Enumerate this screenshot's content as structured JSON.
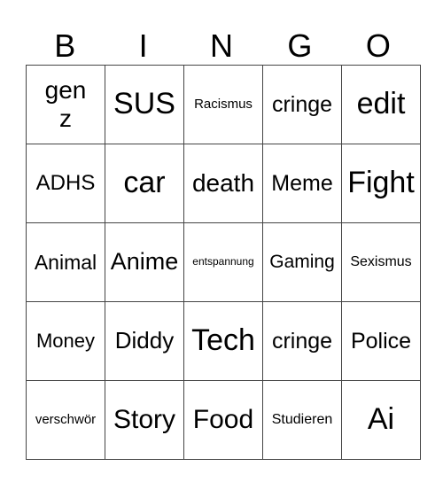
{
  "header": [
    "B",
    "I",
    "N",
    "G",
    "O"
  ],
  "cells": [
    [
      {
        "t": "gen z",
        "s": 28
      },
      {
        "t": "SUS",
        "s": 34
      },
      {
        "t": "Racismus",
        "s": 15
      },
      {
        "t": "cringe",
        "s": 25
      },
      {
        "t": "edit",
        "s": 34
      }
    ],
    [
      {
        "t": "ADHS",
        "s": 24
      },
      {
        "t": "car",
        "s": 34
      },
      {
        "t": "death",
        "s": 28
      },
      {
        "t": "Meme",
        "s": 25
      },
      {
        "t": "Fight",
        "s": 34
      }
    ],
    [
      {
        "t": "Animal",
        "s": 23
      },
      {
        "t": "Anime",
        "s": 27
      },
      {
        "t": "entspannung",
        "s": 12
      },
      {
        "t": "Gaming",
        "s": 21
      },
      {
        "t": "Sexismus",
        "s": 16
      }
    ],
    [
      {
        "t": "Money",
        "s": 22
      },
      {
        "t": "Diddy",
        "s": 26
      },
      {
        "t": "Tech",
        "s": 34
      },
      {
        "t": "cringe",
        "s": 25
      },
      {
        "t": "Police",
        "s": 25
      }
    ],
    [
      {
        "t": "verschwör",
        "s": 15
      },
      {
        "t": "Story",
        "s": 30
      },
      {
        "t": "Food",
        "s": 30
      },
      {
        "t": "Studieren",
        "s": 16
      },
      {
        "t": "Ai",
        "s": 34
      }
    ]
  ]
}
